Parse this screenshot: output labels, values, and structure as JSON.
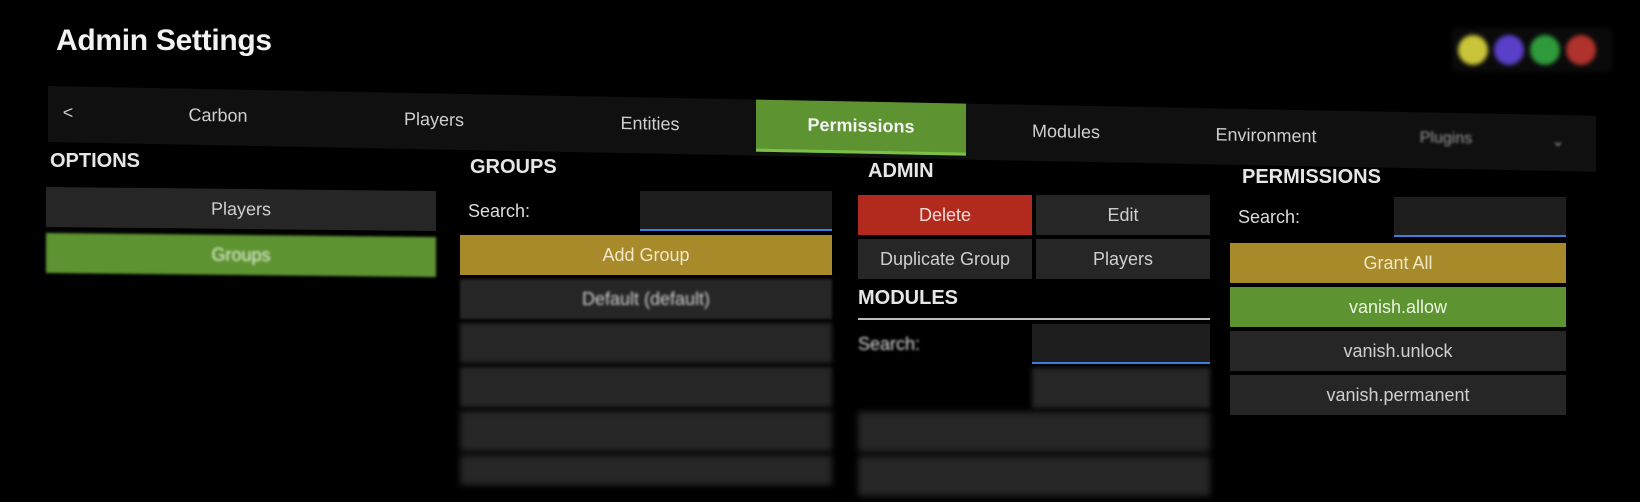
{
  "header": {
    "title": "Admin Settings"
  },
  "window_controls": {
    "colors": [
      "#c9c43a",
      "#5a3fc9",
      "#2f9a3c",
      "#b0322c"
    ]
  },
  "tabs": {
    "back_label": "<",
    "items": [
      {
        "label": "Carbon"
      },
      {
        "label": "Players"
      },
      {
        "label": "Entities"
      },
      {
        "label": "Permissions",
        "active": true
      },
      {
        "label": "Modules"
      },
      {
        "label": "Environment"
      },
      {
        "label": "Plugins"
      }
    ],
    "overflow_icon": "chevron-down-icon"
  },
  "options": {
    "title": "OPTIONS",
    "items": [
      {
        "label": "Players"
      },
      {
        "label": "Groups",
        "active": true
      }
    ]
  },
  "groups": {
    "title": "GROUPS",
    "search_label": "Search:",
    "search_value": "",
    "add_label": "Add Group",
    "items": [
      {
        "label": "Default  (default)"
      }
    ]
  },
  "admin": {
    "title": "ADMIN",
    "delete_label": "Delete",
    "edit_label": "Edit",
    "duplicate_label": "Duplicate Group",
    "players_label": "Players"
  },
  "modules": {
    "title": "MODULES",
    "search_label": "Search:",
    "search_value": ""
  },
  "permissions": {
    "title": "PERMISSIONS",
    "search_label": "Search:",
    "search_value": "",
    "grant_all_label": "Grant All",
    "items": [
      {
        "label": "vanish.allow",
        "granted": true
      },
      {
        "label": "vanish.unlock",
        "granted": false
      },
      {
        "label": "vanish.permanent",
        "granted": false
      }
    ]
  },
  "colors": {
    "accent_green": "#5e9331",
    "accent_yellow": "#a88a2a",
    "danger_red": "#b22a1e",
    "input_underline": "#3f7fe0"
  }
}
